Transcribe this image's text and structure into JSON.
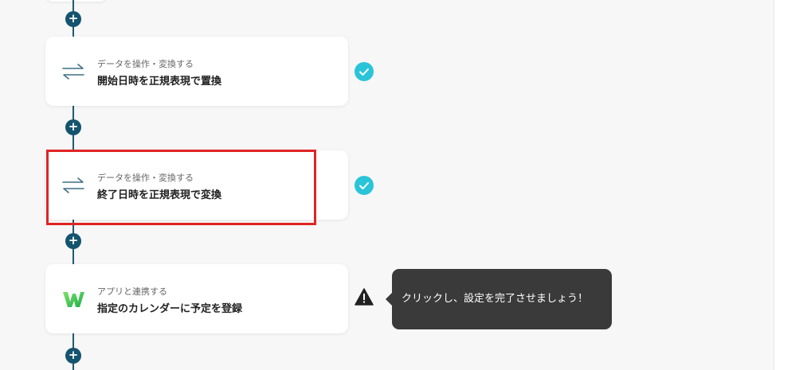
{
  "flow": {
    "steps": [
      {
        "category": "データを操作・変換する",
        "title": "開始日時を正規表現で置換",
        "icon": "swap-arrows-icon",
        "status": "completed"
      },
      {
        "category": "データを操作・変換する",
        "title": "終了日時を正規表現で変換",
        "icon": "swap-arrows-icon",
        "status": "completed"
      },
      {
        "category": "アプリと連携する",
        "title": "指定のカレンダーに予定を登録",
        "icon": "app-logo-w-icon",
        "status": "warning"
      }
    ],
    "add_step_symbol": "+"
  },
  "tooltip": {
    "text": "クリックし、設定を完了させましょう！"
  },
  "colors": {
    "connector": "#15546e",
    "check": "#2ac4d9",
    "highlight": "#e02424",
    "tooltip_bg": "#3a3a3a"
  }
}
